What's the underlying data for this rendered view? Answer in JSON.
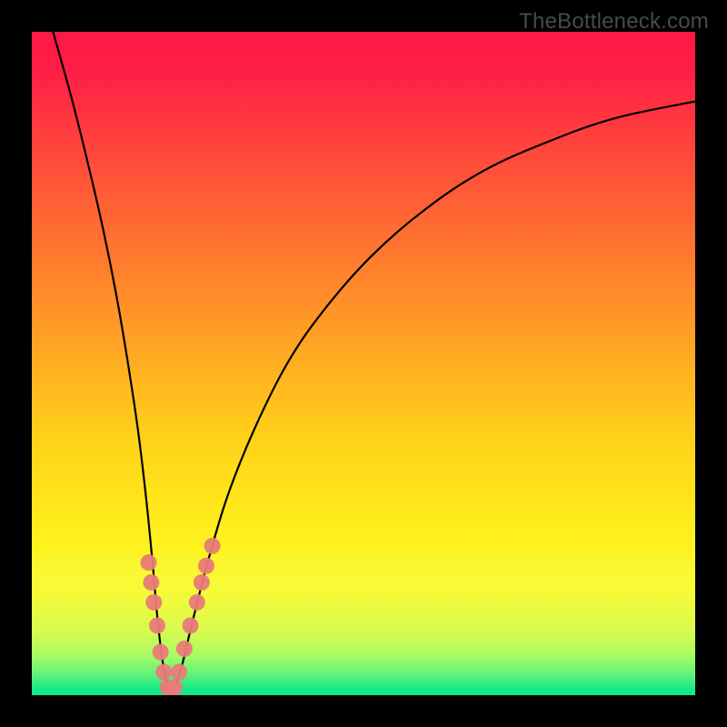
{
  "watermark": "TheBottleneck.com",
  "chart_data": {
    "type": "line",
    "title": "",
    "xlabel": "",
    "ylabel": "",
    "xlim": [
      0,
      1
    ],
    "ylim": [
      0,
      1
    ],
    "curves": {
      "left": [
        {
          "x": 0.032,
          "y": 1.0
        },
        {
          "x": 0.06,
          "y": 0.9
        },
        {
          "x": 0.085,
          "y": 0.8
        },
        {
          "x": 0.108,
          "y": 0.7
        },
        {
          "x": 0.128,
          "y": 0.6
        },
        {
          "x": 0.145,
          "y": 0.5
        },
        {
          "x": 0.16,
          "y": 0.4
        },
        {
          "x": 0.172,
          "y": 0.3
        },
        {
          "x": 0.182,
          "y": 0.2
        },
        {
          "x": 0.19,
          "y": 0.11
        },
        {
          "x": 0.199,
          "y": 0.04
        },
        {
          "x": 0.21,
          "y": 0.0
        }
      ],
      "right": [
        {
          "x": 0.21,
          "y": 0.0
        },
        {
          "x": 0.225,
          "y": 0.04
        },
        {
          "x": 0.242,
          "y": 0.11
        },
        {
          "x": 0.265,
          "y": 0.2
        },
        {
          "x": 0.295,
          "y": 0.3
        },
        {
          "x": 0.335,
          "y": 0.4
        },
        {
          "x": 0.385,
          "y": 0.5
        },
        {
          "x": 0.44,
          "y": 0.58
        },
        {
          "x": 0.51,
          "y": 0.66
        },
        {
          "x": 0.59,
          "y": 0.73
        },
        {
          "x": 0.68,
          "y": 0.79
        },
        {
          "x": 0.78,
          "y": 0.835
        },
        {
          "x": 0.88,
          "y": 0.87
        },
        {
          "x": 1.0,
          "y": 0.895
        }
      ]
    },
    "data_markers": [
      {
        "x": 0.176,
        "y": 0.2
      },
      {
        "x": 0.18,
        "y": 0.17
      },
      {
        "x": 0.184,
        "y": 0.14
      },
      {
        "x": 0.189,
        "y": 0.105
      },
      {
        "x": 0.194,
        "y": 0.065
      },
      {
        "x": 0.199,
        "y": 0.035
      },
      {
        "x": 0.205,
        "y": 0.012
      },
      {
        "x": 0.21,
        "y": 0.0
      },
      {
        "x": 0.215,
        "y": 0.012
      },
      {
        "x": 0.222,
        "y": 0.035
      },
      {
        "x": 0.23,
        "y": 0.07
      },
      {
        "x": 0.239,
        "y": 0.105
      },
      {
        "x": 0.249,
        "y": 0.14
      },
      {
        "x": 0.256,
        "y": 0.17
      },
      {
        "x": 0.263,
        "y": 0.195
      },
      {
        "x": 0.272,
        "y": 0.225
      }
    ],
    "marker_color": "#e97b78",
    "curve_color": "#000000",
    "gradient_stops": [
      {
        "pos": 0.0,
        "color": "#ff1846"
      },
      {
        "pos": 0.5,
        "color": "#ffb81f"
      },
      {
        "pos": 0.8,
        "color": "#fff320"
      },
      {
        "pos": 1.0,
        "color": "#10e88c"
      }
    ]
  }
}
